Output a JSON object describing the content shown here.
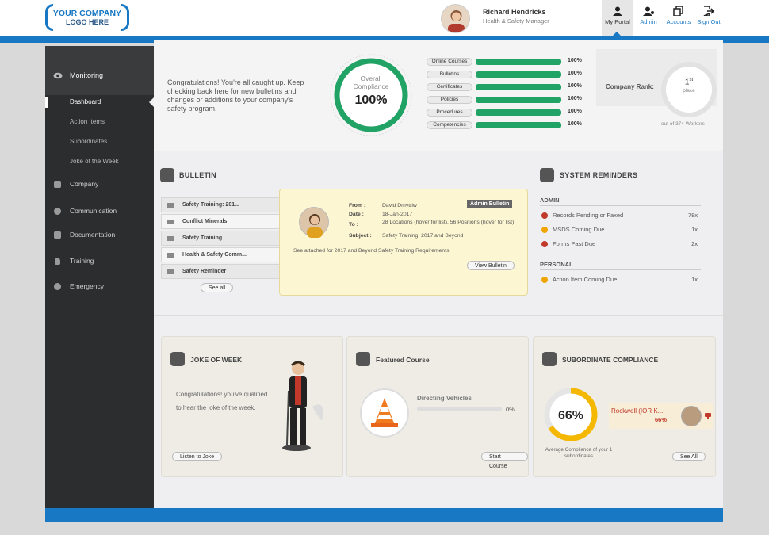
{
  "header": {
    "logo_line1": "YOUR COMPANY",
    "logo_line2": "LOGO HERE",
    "user_name": "Richard Hendricks",
    "user_role": "Health & Safety Manager",
    "nav": [
      {
        "label": "My Portal",
        "icon": "person-icon",
        "active": true
      },
      {
        "label": "Admin",
        "icon": "admin-icon"
      },
      {
        "label": "Accounts",
        "icon": "accounts-icon"
      },
      {
        "label": "Sign Out",
        "icon": "sign-out-icon"
      }
    ]
  },
  "sidebar": {
    "monitoring": {
      "label": "Monitoring",
      "icon": "eye-icon"
    },
    "sub_items": [
      "Dashboard",
      "Action Items",
      "Subordinates",
      "Joke of the Week"
    ],
    "items": [
      {
        "label": "Company",
        "icon": "briefcase-icon"
      },
      {
        "label": "Communication",
        "icon": "chat-icon"
      },
      {
        "label": "Documentation",
        "icon": "document-icon"
      },
      {
        "label": "Training",
        "icon": "bulb-icon"
      },
      {
        "label": "Emergency",
        "icon": "plus-circle-icon"
      }
    ]
  },
  "overview": {
    "congrats": "Congratulations! You're all caught up. Keep checking back here for new bulletins and changes or additions to your company's safety program.",
    "gauge_label1": "Overall",
    "gauge_label2": "Compliance",
    "gauge_value": "100%",
    "gauge_fraction": 1.0,
    "progress": [
      {
        "label": "Online Courses",
        "pct": "100%",
        "fraction": 1.0
      },
      {
        "label": "Bulletins",
        "pct": "100%",
        "fraction": 1.0
      },
      {
        "label": "Certificates",
        "pct": "100%",
        "fraction": 1.0
      },
      {
        "label": "Policies",
        "pct": "100%",
        "fraction": 1.0
      },
      {
        "label": "Procedures",
        "pct": "100%",
        "fraction": 1.0
      },
      {
        "label": "Competencies",
        "pct": "100%",
        "fraction": 1.0
      }
    ],
    "rank_label": "Company Rank:",
    "rank_number": "1",
    "rank_suffix": "st",
    "rank_place": "place",
    "rank_out_of": "out of 374 Workers"
  },
  "bulletin": {
    "title": "BULLETIN",
    "items": [
      "Safety Training: 201...",
      "Conflict Minerals",
      "Safety Training",
      "Health & Safety Comm...",
      "Safety Reminder"
    ],
    "see_all": "See all",
    "popup": {
      "tag": "Admin Bulletin",
      "from_k": "From :",
      "from_v": "David Dmytriw",
      "date_k": "Date :",
      "date_v": "18-Jan-2017",
      "to_k": "To :",
      "to_v": "28 Locations (hover for list), 56 Positions (hover for list)",
      "subject_k": "Subject :",
      "subject_v": "Safety Training: 2017 and Beyond",
      "message": "See attached for 2017 and Beyond Safety Training Requirements:",
      "button": "View Bulletin"
    }
  },
  "reminders": {
    "title": "SYSTEM REMINDERS",
    "admin_head": "ADMIN",
    "admin": [
      {
        "text": "Records Pending or Faxed",
        "count": "78x",
        "color": "#c0392b"
      },
      {
        "text": "MSDS Coming Due",
        "count": "1x",
        "color": "#f0a500"
      },
      {
        "text": "Forms Past Due",
        "count": "2x",
        "color": "#c0392b"
      }
    ],
    "personal_head": "PERSONAL",
    "personal": [
      {
        "text": "Action Item Coming Due",
        "count": "1x",
        "color": "#f0a500"
      }
    ]
  },
  "joke": {
    "title": "JOKE OF WEEK",
    "text": "Congratulations! you've qualified to hear the joke of the week.",
    "button": "Listen to Joke"
  },
  "course": {
    "title": "Featured Course",
    "name": "Directing Vehicles",
    "pct": "0%",
    "fraction": 0,
    "button": "Start Course"
  },
  "subordinate": {
    "title": "SUBORDINATE COMPLIANCE",
    "value": "66%",
    "fraction": 0.66,
    "label": "Average Compliance of your 1 subordinates",
    "person_name": "Rockwell (IOR K...",
    "person_pct": "66%",
    "button": "See All"
  },
  "colors": {
    "accent": "#1878c3",
    "green": "#21a366",
    "gold": "#f5b800"
  }
}
